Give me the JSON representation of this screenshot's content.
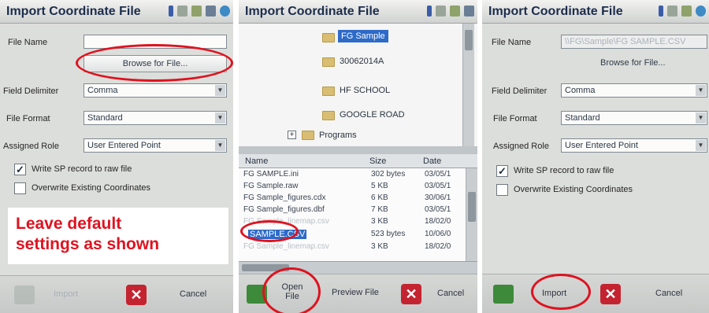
{
  "colors": {
    "annotation_red": "#e0121f",
    "selection_blue": "#2e6ac8",
    "cancel_red": "#c42430",
    "ok_green": "#3d8a3a"
  },
  "panel1": {
    "title": "Import Coordinate File",
    "file_name_label": "File Name",
    "browse_label": "Browse for File...",
    "field_delimiter_label": "Field Delimiter",
    "field_delimiter_value": "Comma",
    "file_format_label": "File Format",
    "file_format_value": "Standard",
    "assigned_role_label": "Assigned Role",
    "assigned_role_value": "User Entered Point",
    "write_sp_label": "Write SP record to raw file",
    "overwrite_label": "Overwrite Existing Coordinates",
    "callout_line1": "Leave default",
    "callout_line2": "settings as shown",
    "import_label": "Import",
    "cancel_label": "Cancel"
  },
  "panel2": {
    "title": "Import Coordinate File",
    "tree_items": [
      "FG Sample",
      "30062014A",
      "HF SCHOOL",
      "GOOGLE ROAD",
      "Programs"
    ],
    "columns": [
      "Name",
      "Size",
      "Date"
    ],
    "files": [
      {
        "name": "FG SAMPLE.ini",
        "size": "302 bytes",
        "date": "03/05/1"
      },
      {
        "name": "FG Sample.raw",
        "size": "5 KB",
        "date": "03/05/1"
      },
      {
        "name": "FG Sample_figures.cdx",
        "size": "6 KB",
        "date": "30/06/1"
      },
      {
        "name": "FG Sample_figures.dbf",
        "size": "7 KB",
        "date": "03/05/1"
      },
      {
        "name": "FG Sample_linemap.csv",
        "size": "3 KB",
        "date": "18/02/0"
      },
      {
        "name": "SAMPLE.CSV",
        "size": "523 bytes",
        "date": "10/06/0"
      },
      {
        "name": "FG Sample_linemap.csv",
        "size": "3 KB",
        "date": "18/02/0"
      }
    ],
    "open_file_label": "Open File",
    "preview_file_label": "Preview File",
    "cancel_label": "Cancel"
  },
  "panel3": {
    "title": "Import Coordinate File",
    "file_name_label": "File Name",
    "file_name_value": "\\\\FG\\Sample\\FG SAMPLE.CSV",
    "browse_label": "Browse for File...",
    "field_delimiter_label": "Field Delimiter",
    "field_delimiter_value": "Comma",
    "file_format_label": "File Format",
    "file_format_value": "Standard",
    "assigned_role_label": "Assigned Role",
    "assigned_role_value": "User Entered Point",
    "write_sp_label": "Write SP record to raw file",
    "overwrite_label": "Overwrite Existing Coordinates",
    "import_label": "Import",
    "cancel_label": "Cancel"
  }
}
